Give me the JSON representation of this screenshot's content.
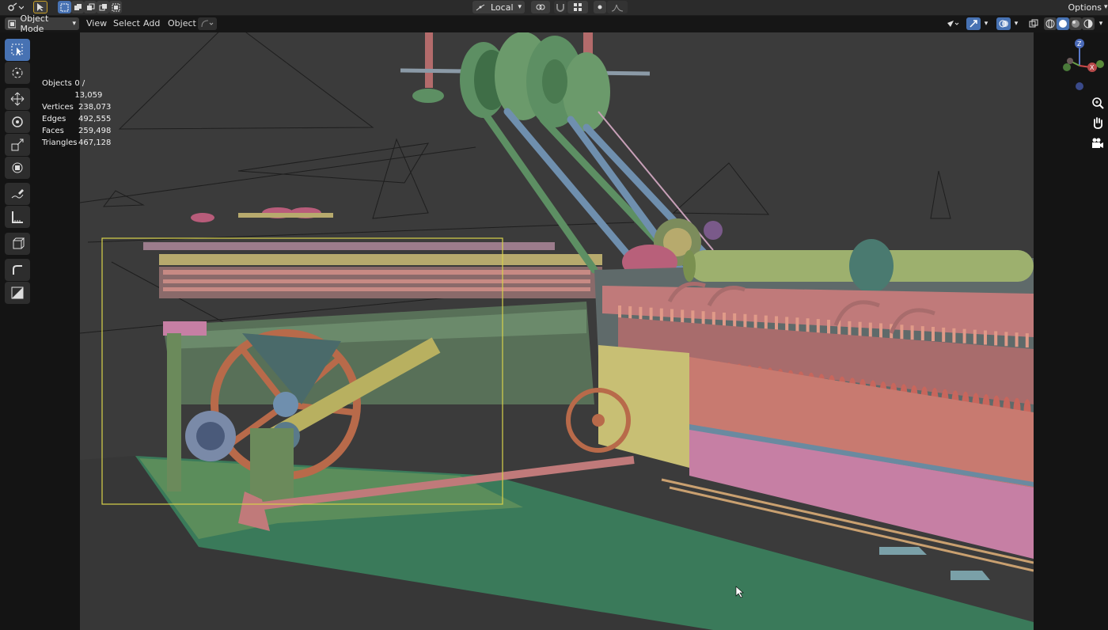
{
  "header": {
    "orientation": "Local",
    "mode": "Object Mode",
    "options": "Options"
  },
  "menus": [
    "View",
    "Select",
    "Add",
    "Object"
  ],
  "stats": [
    {
      "label": "Objects",
      "value": "0 / 13,059"
    },
    {
      "label": "Vertices",
      "value": "238,073"
    },
    {
      "label": "Edges",
      "value": "492,555"
    },
    {
      "label": "Faces",
      "value": "259,498"
    },
    {
      "label": "Triangles",
      "value": "467,128"
    }
  ],
  "gizmo": {
    "x": "X",
    "z": "Z"
  },
  "tools": [
    "select-box-icon",
    "cursor-icon",
    "move-icon",
    "rotate-icon",
    "scale-icon",
    "transform-icon",
    "annotate-icon",
    "measure-icon",
    "add-cube-icon",
    "shear-icon",
    "scale-cage-icon"
  ],
  "colors": {
    "accent": "#4772b3",
    "viewport": "#3b3b3b",
    "selection": "#d8d24a"
  }
}
